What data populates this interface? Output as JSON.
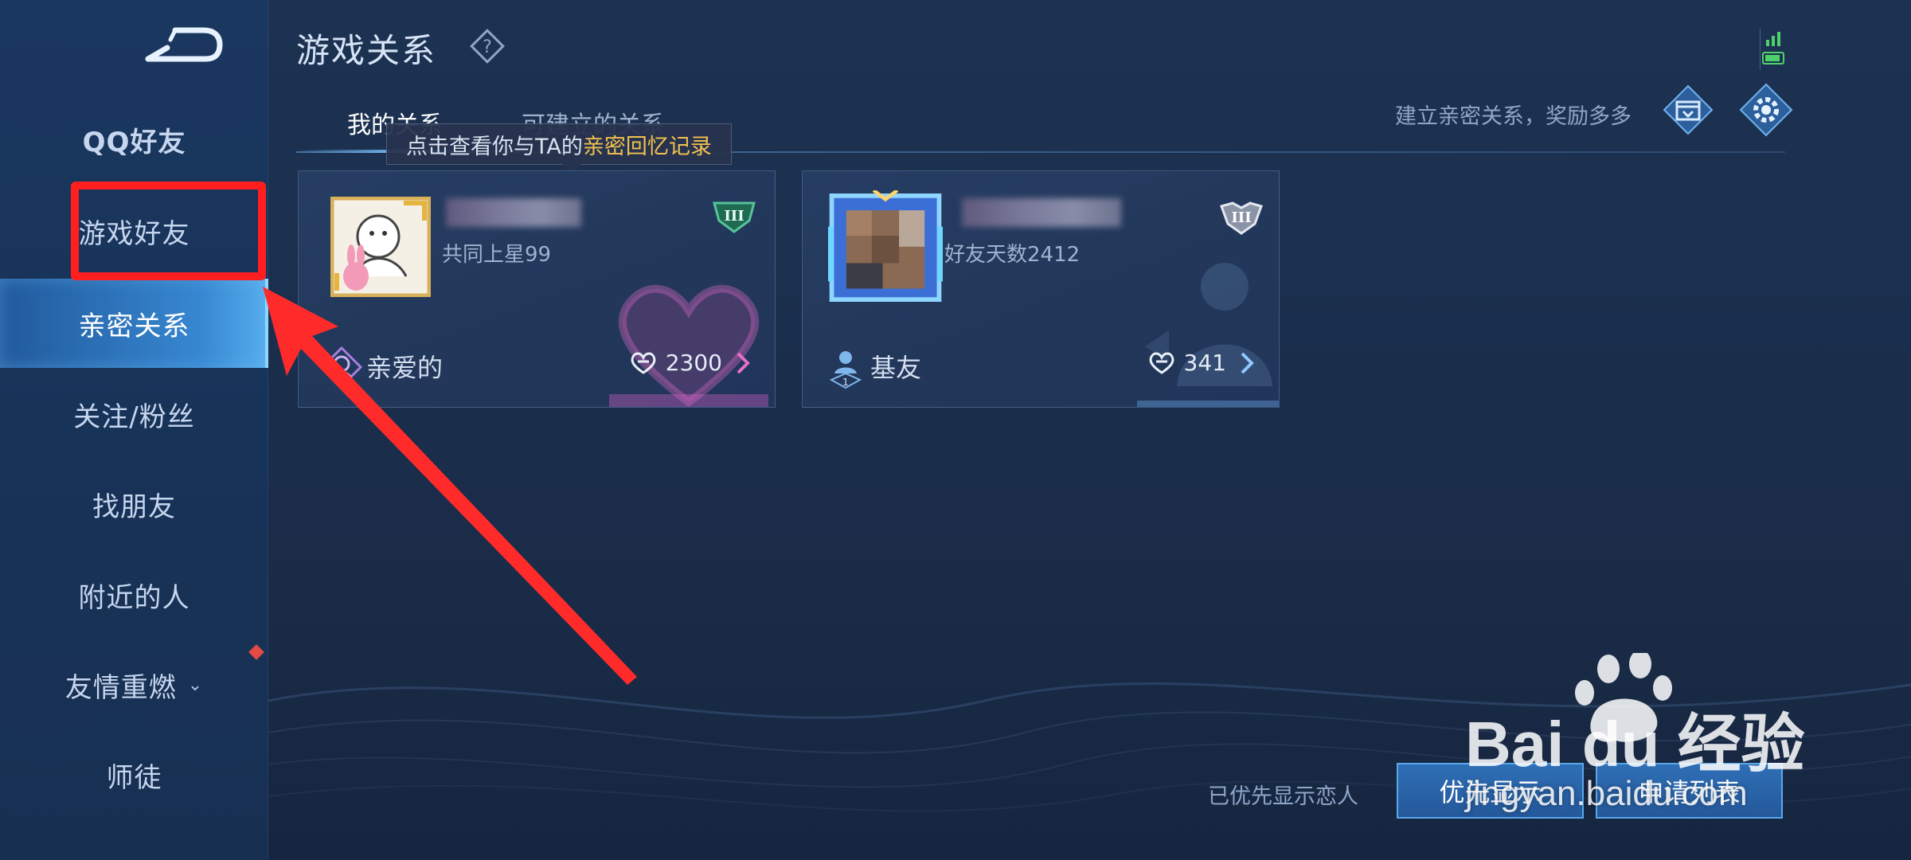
{
  "header": {
    "title": "游戏关系",
    "promo_text": "建立亲密关系，奖励多多"
  },
  "sidebar": {
    "items": [
      {
        "label": "QQ好友"
      },
      {
        "label": "游戏好友"
      },
      {
        "label": "亲密关系",
        "active": true
      },
      {
        "label": "关注/粉丝"
      },
      {
        "label": "找朋友"
      },
      {
        "label": "附近的人"
      },
      {
        "label": "友情重燃",
        "has_dropdown": true,
        "has_notification_dot": true
      },
      {
        "label": "师徒"
      }
    ]
  },
  "tabs": [
    {
      "label": "我的关系",
      "active": true
    },
    {
      "label": "可建立的关系"
    }
  ],
  "tooltip": {
    "prefix": "点击查看你与TA的",
    "highlight": "亲密回忆记录"
  },
  "cards": [
    {
      "subtitle": "共同上星99",
      "relation": "亲爱的",
      "intimacy": "2300",
      "rank_badge": "III"
    },
    {
      "subtitle": "好友天数2412",
      "relation": "基友",
      "relation_level": "1",
      "intimacy": "341",
      "rank_badge": "III"
    }
  ],
  "footer": {
    "pinned_text": "已优先显示恋人",
    "priority_button": "优先显示",
    "requests_button": "申请列表"
  },
  "watermark": {
    "logo_text": "Bai du 经验",
    "url": "jingyan.baidu.com"
  },
  "colors": {
    "accent": "#7cc6ff",
    "highlight_red": "#ff1f1f",
    "gold": "#f2c14e",
    "button_blue": "#2f6fb6"
  }
}
